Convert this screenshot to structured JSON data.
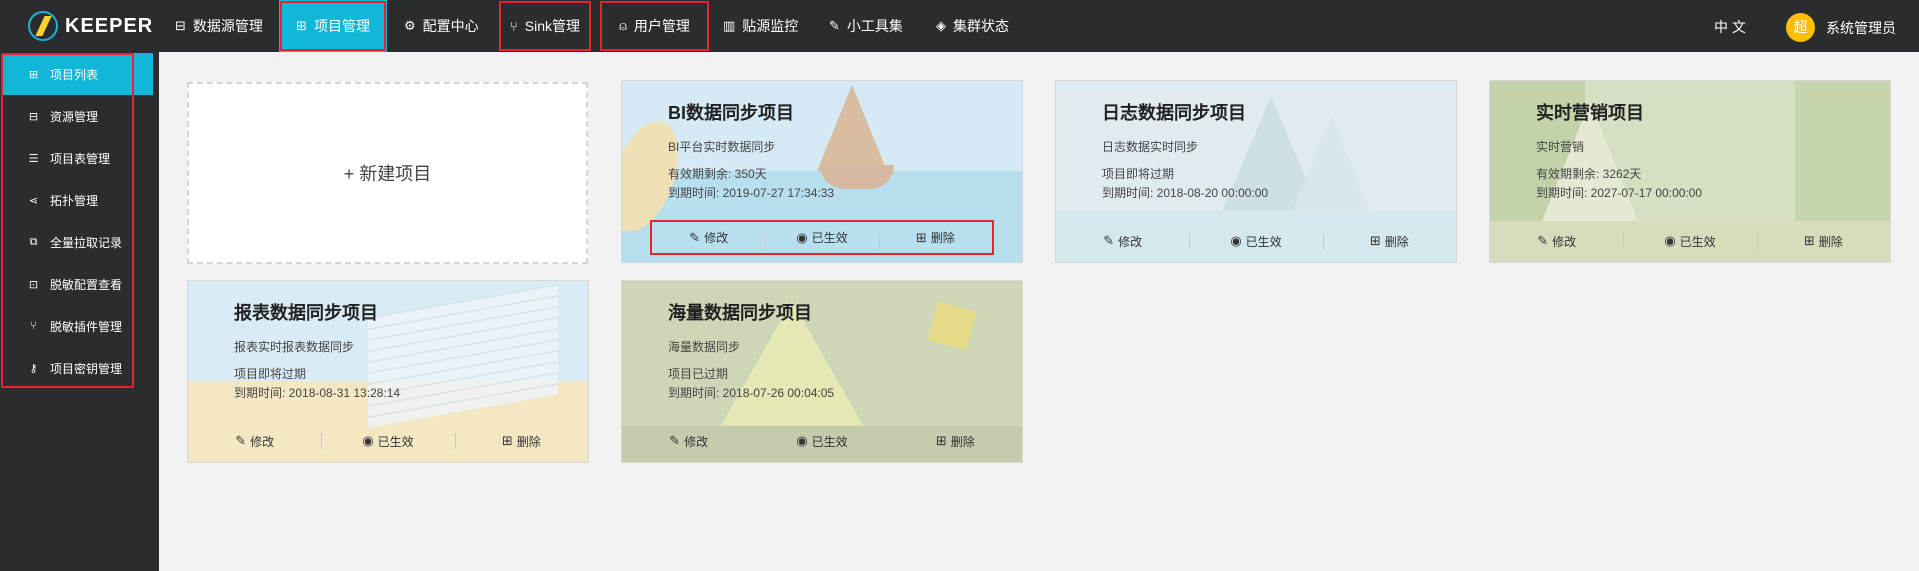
{
  "header": {
    "logo_text": "KEEPER",
    "nav": [
      {
        "label": "数据源管理",
        "icon": "database-icon",
        "glyph": "⊟"
      },
      {
        "label": "项目管理",
        "icon": "grid-icon",
        "glyph": "⊞"
      },
      {
        "label": "配置中心",
        "icon": "gear-icon",
        "glyph": "⚙"
      },
      {
        "label": "Sink管理",
        "icon": "sink-icon",
        "glyph": "⑂"
      },
      {
        "label": "用户管理",
        "icon": "user-icon",
        "glyph": "⍝"
      },
      {
        "label": "贴源监控",
        "icon": "chart-icon",
        "glyph": "▥"
      },
      {
        "label": "小工具集",
        "icon": "wrench-icon",
        "glyph": "✎"
      },
      {
        "label": "集群状态",
        "icon": "shield-icon",
        "glyph": "◈"
      }
    ],
    "language": "中 文",
    "avatar_text": "超",
    "user_name": "系统管理员"
  },
  "sidebar": {
    "items": [
      {
        "label": "项目列表",
        "icon": "grid-icon",
        "glyph": "⊞"
      },
      {
        "label": "资源管理",
        "icon": "database-icon",
        "glyph": "⊟"
      },
      {
        "label": "项目表管理",
        "icon": "table-icon",
        "glyph": "☰"
      },
      {
        "label": "拓扑管理",
        "icon": "share-icon",
        "glyph": "⋖"
      },
      {
        "label": "全量拉取记录",
        "icon": "copy-icon",
        "glyph": "⧉"
      },
      {
        "label": "脱敏配置查看",
        "icon": "lock-icon",
        "glyph": "⊡"
      },
      {
        "label": "脱敏插件管理",
        "icon": "plugin-icon",
        "glyph": "⑂"
      },
      {
        "label": "项目密钥管理",
        "icon": "key-icon",
        "glyph": "⚷"
      }
    ]
  },
  "main": {
    "new_project_label": "+ 新建项目",
    "actions": {
      "edit": "修改",
      "status": "已生效",
      "delete": "删除"
    },
    "projects": [
      {
        "title": "BI数据同步项目",
        "desc": "BI平台实时数据同步",
        "remain": "有效期剩余: 350天",
        "expire": "到期时间: 2019-07-27 17:34:33"
      },
      {
        "title": "日志数据同步项目",
        "desc": "日志数据实时同步",
        "remain": "项目即将过期",
        "expire": "到期时间: 2018-08-20 00:00:00"
      },
      {
        "title": "实时营销项目",
        "desc": "实时营销",
        "remain": "有效期剩余: 3262天",
        "expire": "到期时间: 2027-07-17 00:00:00"
      },
      {
        "title": "报表数据同步项目",
        "desc": "报表实时报表数据同步",
        "remain": "项目即将过期",
        "expire": "到期时间: 2018-08-31 13:28:14"
      },
      {
        "title": "海量数据同步项目",
        "desc": "海量数据同步",
        "remain": "项目已过期",
        "expire": "到期时间: 2018-07-26 00:04:05"
      }
    ]
  },
  "colors": {
    "topbar": "#2b2c30",
    "accent": "#11b7d7",
    "highlight": "#e8232f",
    "avatar": "#ffbf00"
  }
}
